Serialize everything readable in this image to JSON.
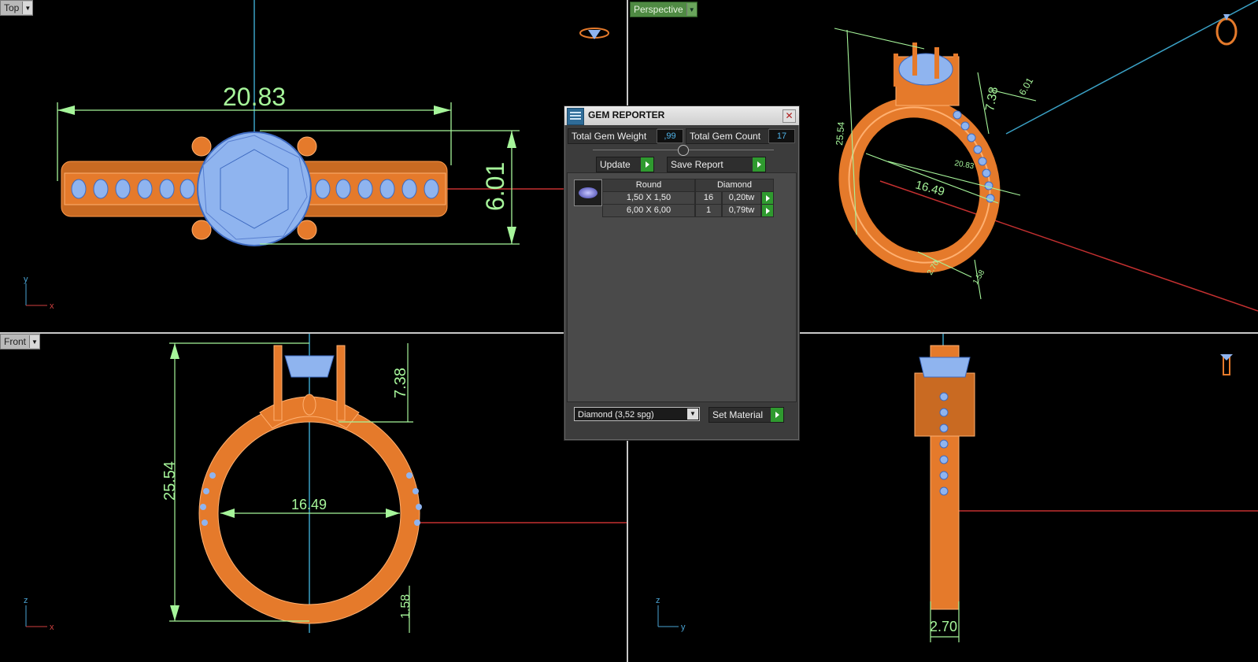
{
  "viewports": {
    "top": {
      "label": "Top",
      "dim_width": "20.83",
      "dim_height": "6.01",
      "axis_x": "x",
      "axis_y": "y"
    },
    "perspective": {
      "label": "Perspective",
      "dim_a": "25.54",
      "dim_b": "7.38",
      "dim_c": "6.01",
      "dim_d": "16.49",
      "dim_e": "20.83",
      "dim_f": "2.70",
      "dim_g": "1.58"
    },
    "front": {
      "label": "Front",
      "dim_height": "25.54",
      "dim_top": "7.38",
      "dim_inner": "16.49",
      "dim_bottom": "1.58",
      "axis_x": "x",
      "axis_z": "z"
    },
    "right": {
      "dim_width": "2.70",
      "axis_y": "y",
      "axis_z": "z"
    }
  },
  "gem_reporter": {
    "title": "GEM REPORTER",
    "total_weight_label": "Total Gem Weight",
    "total_weight_value": ",99",
    "total_count_label": "Total Gem Count",
    "total_count_value": "17",
    "update_label": "Update",
    "save_report_label": "Save Report",
    "table": {
      "headers": [
        "Round",
        "Diamond"
      ],
      "rows": [
        {
          "size": "1,50 X 1,50",
          "count": "16",
          "weight": "0,20tw"
        },
        {
          "size": "6,00 X 6,00",
          "count": "1",
          "weight": "0,79tw"
        }
      ]
    },
    "material_select": "Diamond      (3,52 spg)",
    "set_material_label": "Set Material"
  },
  "colors": {
    "gold": "#e57a2b",
    "gem": "#8fb4ef",
    "dimension": "#a6f59a",
    "guide_blue": "#3aa0c4",
    "guide_red": "#c43030"
  }
}
